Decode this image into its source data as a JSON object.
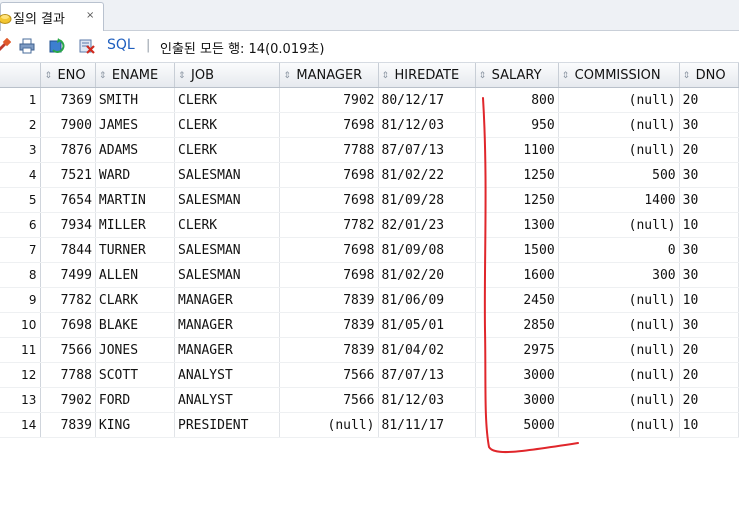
{
  "tab": {
    "label": "질의 결과",
    "close": "×"
  },
  "toolbar": {
    "sql_label": "SQL",
    "separator": "|",
    "status": "인출된 모든 행: 14(0.019초)"
  },
  "grid": {
    "columns": [
      "ENO",
      "ENAME",
      "JOB",
      "MANAGER",
      "HIREDATE",
      "SALARY",
      "COMMISSION",
      "DNO"
    ],
    "rows": [
      [
        "1",
        "7369",
        "SMITH",
        "CLERK",
        "7902",
        "80/12/17",
        "800",
        "(null)",
        "20"
      ],
      [
        "2",
        "7900",
        "JAMES",
        "CLERK",
        "7698",
        "81/12/03",
        "950",
        "(null)",
        "30"
      ],
      [
        "3",
        "7876",
        "ADAMS",
        "CLERK",
        "7788",
        "87/07/13",
        "1100",
        "(null)",
        "20"
      ],
      [
        "4",
        "7521",
        "WARD",
        "SALESMAN",
        "7698",
        "81/02/22",
        "1250",
        "500",
        "30"
      ],
      [
        "5",
        "7654",
        "MARTIN",
        "SALESMAN",
        "7698",
        "81/09/28",
        "1250",
        "1400",
        "30"
      ],
      [
        "6",
        "7934",
        "MILLER",
        "CLERK",
        "7782",
        "82/01/23",
        "1300",
        "(null)",
        "10"
      ],
      [
        "7",
        "7844",
        "TURNER",
        "SALESMAN",
        "7698",
        "81/09/08",
        "1500",
        "0",
        "30"
      ],
      [
        "8",
        "7499",
        "ALLEN",
        "SALESMAN",
        "7698",
        "81/02/20",
        "1600",
        "300",
        "30"
      ],
      [
        "9",
        "7782",
        "CLARK",
        "MANAGER",
        "7839",
        "81/06/09",
        "2450",
        "(null)",
        "10"
      ],
      [
        "10",
        "7698",
        "BLAKE",
        "MANAGER",
        "7839",
        "81/05/01",
        "2850",
        "(null)",
        "30"
      ],
      [
        "11",
        "7566",
        "JONES",
        "MANAGER",
        "7839",
        "81/04/02",
        "2975",
        "(null)",
        "20"
      ],
      [
        "12",
        "7788",
        "SCOTT",
        "ANALYST",
        "7566",
        "87/07/13",
        "3000",
        "(null)",
        "20"
      ],
      [
        "13",
        "7902",
        "FORD",
        "ANALYST",
        "7566",
        "81/12/03",
        "3000",
        "(null)",
        "20"
      ],
      [
        "14",
        "7839",
        "KING",
        "PRESIDENT",
        "(null)",
        "81/11/17",
        "5000",
        "(null)",
        "10"
      ]
    ]
  },
  "colors": {
    "annotation": "#e0262b",
    "sql_link": "#1f5fbf"
  }
}
